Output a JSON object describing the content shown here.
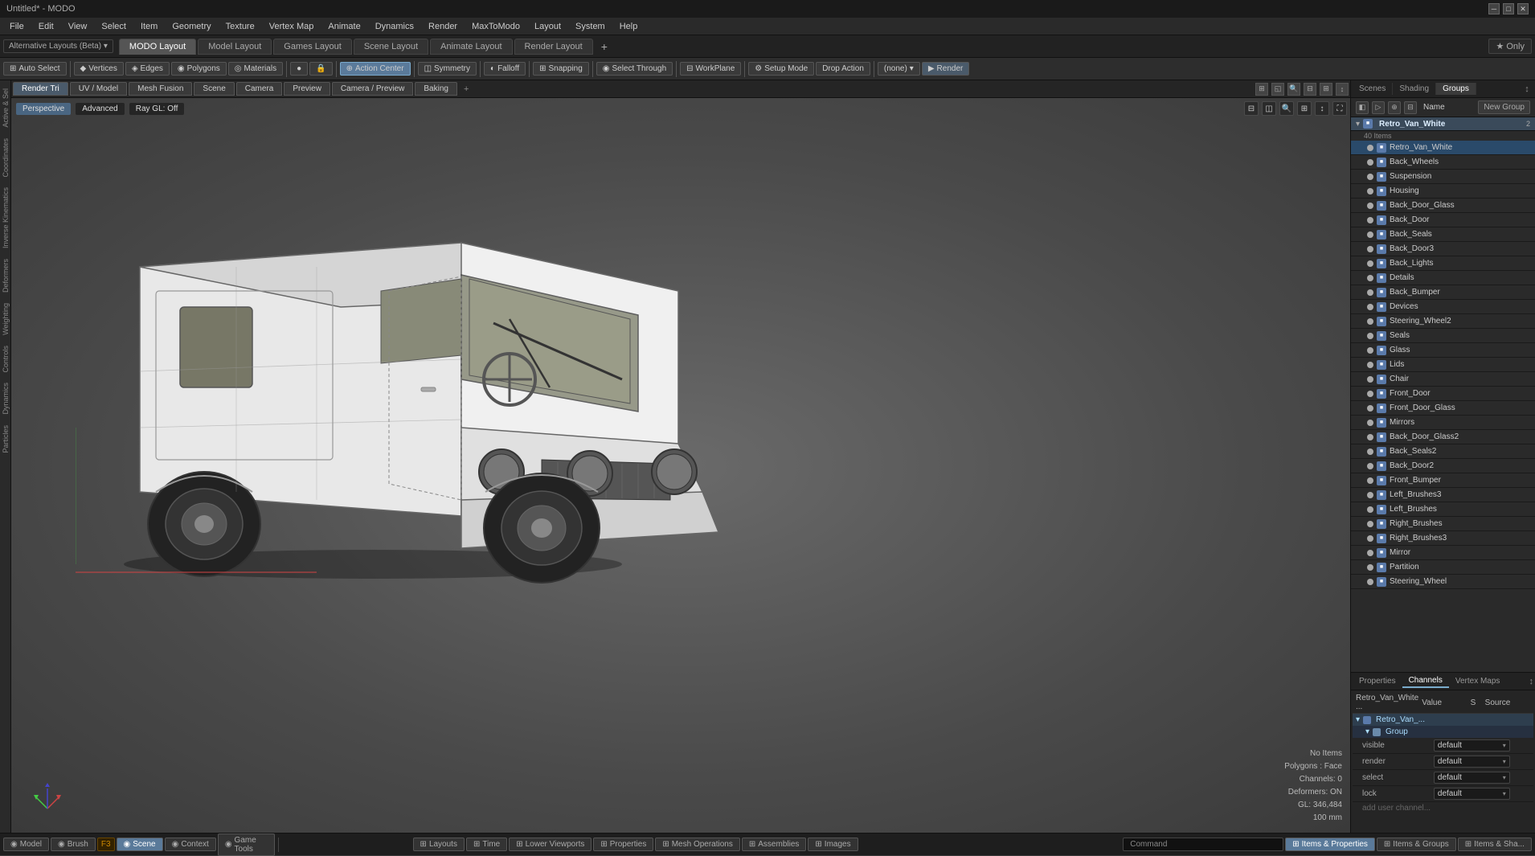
{
  "titleBar": {
    "title": "Untitled* - MODO",
    "minimize": "🗕",
    "maximize": "🗗",
    "close": "✕"
  },
  "menuBar": {
    "items": [
      "File",
      "Edit",
      "View",
      "Select",
      "Item",
      "Geometry",
      "Texture",
      "Vertex Map",
      "Animate",
      "Dynamics",
      "Render",
      "MaxToModo",
      "Layout",
      "System",
      "Help"
    ]
  },
  "layoutTabs": {
    "tabs": [
      "MODO Layout",
      "Model Layout",
      "Games Layout",
      "Scene Layout",
      "Animate Layout",
      "Render Layout"
    ],
    "active": 0,
    "starOnly": "★  Only"
  },
  "toolbar": {
    "autoSelect": "Auto Select",
    "vertices": "Vertices",
    "edges": "Edges",
    "polygons": "Polygons",
    "materials": "Materials",
    "actionCenter": "Action Center",
    "symmetry": "Symmetry",
    "falloff": "Falloff",
    "snapping": "Snapping",
    "selectThrough": "Select Through",
    "workPlane": "WorkPlane",
    "setupMode": "Setup Mode",
    "dropAction": "Drop Action",
    "renderDropdown": "(none)",
    "render": "Render"
  },
  "viewportTabs": {
    "tabs": [
      "Render Tri",
      "UV / Model",
      "Mesh Fusion",
      "Scene",
      "Camera",
      "Preview",
      "Camera / Preview",
      "Baking"
    ],
    "active": 0
  },
  "viewportLabels": {
    "perspective": "Perspective",
    "advanced": "Advanced",
    "rayGL": "Ray GL: Off"
  },
  "viewportInfo": {
    "noItems": "No Items",
    "polygons": "Polygons : Face",
    "channels": "Channels: 0",
    "deformers": "Deformers: ON",
    "gl": "GL: 346,484",
    "size": "100 mm"
  },
  "rightPanel": {
    "tabs": [
      "Scenes",
      "Shading",
      "Groups"
    ],
    "activeTab": 2
  },
  "groupsPanel": {
    "newGroup": "New Group",
    "colName": "Name",
    "rootItem": "Retro_Van_White",
    "rootCount": "2",
    "itemCount": "40 Items",
    "items": [
      "Retro_Van_White",
      "Back_Wheels",
      "Suspension",
      "Housing",
      "Back_Door_Glass",
      "Back_Door",
      "Back_Seals",
      "Back_Door3",
      "Back_Lights",
      "Details",
      "Back_Bumper",
      "Devices",
      "Steering_Wheel2",
      "Seals",
      "Glass",
      "Lids",
      "Chair",
      "Front_Door",
      "Front_Door_Glass",
      "Mirrors",
      "Back_Door_Glass2",
      "Back_Seals2",
      "Back_Door2",
      "Front_Bumper",
      "Left_Brushes3",
      "Left_Brushes",
      "Right_Brushes",
      "Right_Brushes3",
      "Mirror",
      "Partition",
      "Steering_Wheel"
    ]
  },
  "propertiesPanel": {
    "tabs": [
      "Properties",
      "Channels",
      "Vertex Maps"
    ],
    "activeTab": 1,
    "headerRow": {
      "retro_van": "Retro_Van_White ...",
      "value": "Value",
      "s": "S",
      "source": "Source"
    },
    "groupLabel": "Retro_Van_...",
    "groupLabel2": "Group",
    "rows": [
      {
        "name": "visible",
        "value": "default"
      },
      {
        "name": "render",
        "value": "default"
      },
      {
        "name": "select",
        "value": "default"
      },
      {
        "name": "lock",
        "value": "default"
      }
    ],
    "addChannel": "add user channel..."
  },
  "leftSidebar": {
    "tabs": [
      "Active & Sel",
      "Active & Sel",
      "Coordinates",
      "Inverse Kinematics",
      "Deformers",
      "Weighting",
      "Controls",
      "Dynamics",
      "Particles"
    ]
  },
  "statusBar": {
    "buttons": [
      "Model",
      "Brush",
      "Scene",
      "Context",
      "Game Tools"
    ],
    "activeButton": 2,
    "f3": "F3",
    "center": [
      "Layouts",
      "Time",
      "Lower Viewports",
      "Properties",
      "Mesh Operations",
      "Assemblies",
      "Images"
    ],
    "command": "Command",
    "itemsProperties": "Items & Properties",
    "itemsGroups": "Items & Groups",
    "itemsShading": "Items & Sha..."
  }
}
